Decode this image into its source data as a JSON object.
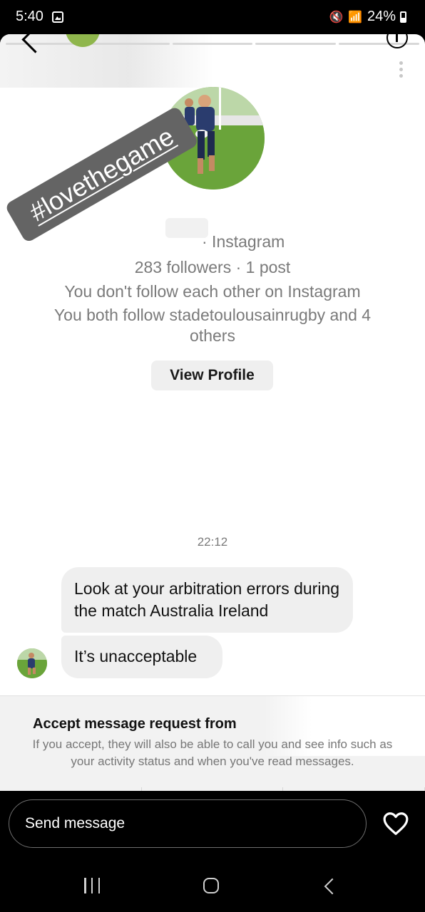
{
  "status_bar": {
    "time": "5:40",
    "battery": "24%",
    "icons": [
      "gallery-icon",
      "mute-icon",
      "wifi-icon",
      "signal-icon",
      "battery-icon"
    ]
  },
  "profile": {
    "sticker_text": "#lovethegame",
    "platform_line": "· Instagram",
    "followers_line": "283 followers · 1 post",
    "follow_status": "You don't follow each other on Instagram",
    "mutual_line_1": "You both follow stadetoulousainrugby and 4",
    "mutual_line_2": "others",
    "view_profile_label": "View Profile"
  },
  "thread": {
    "timestamp": "22:12",
    "messages": [
      {
        "text": "Look at your arbitration errors during the match Australia Ireland"
      },
      {
        "text": "It’s unacceptable"
      }
    ]
  },
  "request": {
    "title": "Accept message request from",
    "body": "If you accept, they will also be able to call you and see info such as your activity status and when you've read messages."
  },
  "composer": {
    "placeholder": "Send message"
  },
  "colors": {
    "background": "#000000",
    "surface": "#ffffff",
    "bubble": "#efefef",
    "muted_text": "#7a7a7a"
  }
}
